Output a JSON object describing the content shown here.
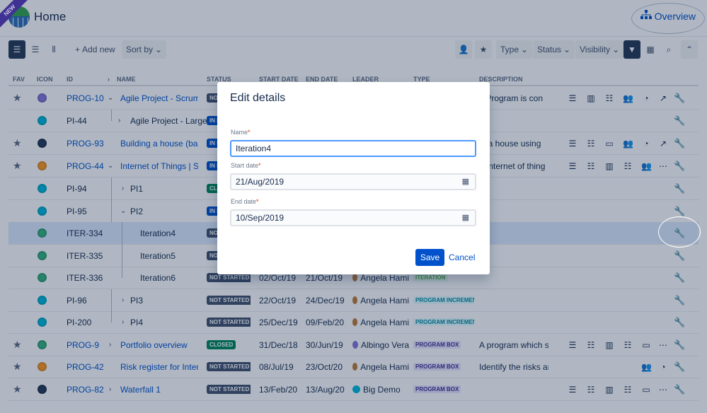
{
  "header": {
    "ribbon": "NEW",
    "title": "Home",
    "overview_label": "Overview"
  },
  "toolbar": {
    "add_new": "Add new",
    "sort_by": "Sort by",
    "type": "Type",
    "status": "Status",
    "visibility": "Visibility"
  },
  "table": {
    "columns": {
      "fav": "FAV",
      "icon": "ICON",
      "id": "ID",
      "name": "NAME",
      "status": "STATUS",
      "start": "START DATE",
      "end": "END DATE",
      "leader": "LEADER",
      "type": "TYPE",
      "description": "DESCRIPTION"
    },
    "rows": [
      {
        "id": "PROG-10",
        "name": "Agile Project - Scrum of",
        "status": "NO",
        "start": "",
        "end": "",
        "leader": "",
        "type": "",
        "desc": "s Program is con"
      },
      {
        "id": "PI-44",
        "name": "Agile Project - Large",
        "status": "IN P",
        "start": "",
        "end": "",
        "leader": "",
        "type": "",
        "desc": ""
      },
      {
        "id": "PROG-93",
        "name": "Building a house (basec",
        "status": "IN P",
        "start": "",
        "end": "",
        "leader": "",
        "type": "",
        "desc": "ld a house using"
      },
      {
        "id": "PROG-44",
        "name": "Internet of Things | SAF",
        "status": "IN P",
        "start": "",
        "end": "",
        "leader": "",
        "type": "",
        "desc": "e Internet of thing"
      },
      {
        "id": "PI-94",
        "name": "PI1",
        "status": "CLO",
        "start": "",
        "end": "",
        "leader": "",
        "type": "",
        "desc": ""
      },
      {
        "id": "PI-95",
        "name": "PI2",
        "status": "IN P",
        "start": "",
        "end": "",
        "leader": "",
        "type": "",
        "desc": ""
      },
      {
        "id": "ITER-334",
        "name": "Iteration4",
        "status": "NOT",
        "start": "",
        "end": "",
        "leader": "",
        "type": "",
        "desc": ""
      },
      {
        "id": "ITER-335",
        "name": "Iteration5",
        "status": "NOT",
        "start": "",
        "end": "",
        "leader": "",
        "type": "",
        "desc": ""
      },
      {
        "id": "ITER-336",
        "name": "Iteration6",
        "status": "NOT STARTED",
        "start": "02/Oct/19",
        "end": "21/Oct/19",
        "leader": "Angela Hami",
        "type": "ITERATION",
        "desc": ""
      },
      {
        "id": "PI-96",
        "name": "PI3",
        "status": "NOT STARTED",
        "start": "22/Oct/19",
        "end": "24/Dec/19",
        "leader": "Angela Hami",
        "type": "PROGRAM INCREMEN",
        "desc": ""
      },
      {
        "id": "PI-200",
        "name": "PI4",
        "status": "NOT STARTED",
        "start": "25/Dec/19",
        "end": "09/Feb/20",
        "leader": "Angela Hami",
        "type": "PROGRAM INCREMEN",
        "desc": ""
      },
      {
        "id": "PROG-9",
        "name": "Portfolio overview",
        "status": "CLOSED",
        "start": "31/Dec/18",
        "end": "30/Jun/19",
        "leader": "Albingo Vera",
        "type": "PROGRAM BOX",
        "desc": "A program which sir"
      },
      {
        "id": "PROG-42",
        "name": "Risk register for Interne",
        "status": "NOT STARTED",
        "start": "08/Jul/19",
        "end": "23/Oct/20",
        "leader": "Angela Hami",
        "type": "PROGRAM BOX",
        "desc": "Identify the risks and"
      },
      {
        "id": "PROG-82",
        "name": "Waterfall 1",
        "status": "NOT STARTED",
        "start": "13/Feb/20",
        "end": "13/Aug/20",
        "leader": "Big Demo",
        "type": "PROGRAM BOX",
        "desc": ""
      }
    ]
  },
  "modal": {
    "title": "Edit details",
    "name_label": "Name",
    "name_value": "Iteration4",
    "start_label": "Start date",
    "start_value": "21/Aug/2019",
    "end_label": "End date",
    "end_value": "10/Sep/2019",
    "required_mark": "*",
    "save": "Save",
    "cancel": "Cancel"
  },
  "colors": {
    "accent": "#0052cc",
    "overlay": "#091e42",
    "ribbon": "#403294"
  }
}
